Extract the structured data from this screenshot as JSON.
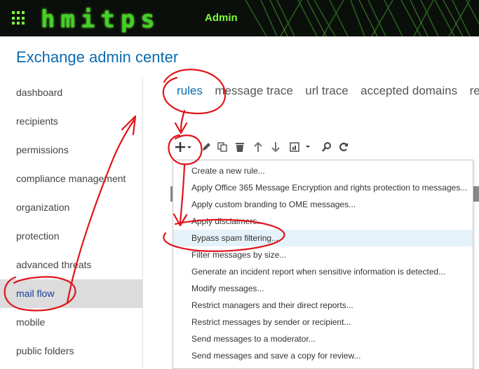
{
  "banner": {
    "logo_text": "hmitps",
    "user_role": "Admin"
  },
  "app": {
    "title": "Exchange admin center"
  },
  "nav": {
    "items": [
      {
        "label": "dashboard"
      },
      {
        "label": "recipients"
      },
      {
        "label": "permissions"
      },
      {
        "label": "compliance management"
      },
      {
        "label": "organization"
      },
      {
        "label": "protection"
      },
      {
        "label": "advanced threats"
      },
      {
        "label": "mail flow",
        "active": true
      },
      {
        "label": "mobile"
      },
      {
        "label": "public folders"
      }
    ]
  },
  "tabs": [
    {
      "label": "rules",
      "active": true
    },
    {
      "label": "message trace"
    },
    {
      "label": "url trace"
    },
    {
      "label": "accepted domains"
    },
    {
      "label": "ren"
    }
  ],
  "toolbar": {
    "icons": [
      "add-icon",
      "edit-icon",
      "copy-icon",
      "delete-icon",
      "move-up-icon",
      "move-down-icon",
      "report-icon",
      "search-icon",
      "refresh-icon"
    ]
  },
  "menu": {
    "items": [
      {
        "label": "Create a new rule..."
      },
      {
        "label": "Apply Office 365 Message Encryption and rights protection to messages..."
      },
      {
        "label": "Apply custom branding to OME messages..."
      },
      {
        "label": "Apply disclaimers..."
      },
      {
        "label": "Bypass spam filtering...",
        "highlighted": true
      },
      {
        "label": "Filter messages by size..."
      },
      {
        "label": "Generate an incident report when sensitive information is detected..."
      },
      {
        "label": "Modify messages..."
      },
      {
        "label": "Restrict managers and their direct reports..."
      },
      {
        "label": "Restrict messages by sender or recipient..."
      },
      {
        "label": "Send messages to a moderator..."
      },
      {
        "label": "Send messages and save a copy for review..."
      }
    ]
  },
  "colors": {
    "accent": "#0b6bb0",
    "annotation": "#e0141a",
    "banner_green": "#7dff3a",
    "highlight": "#e6f2fa"
  }
}
